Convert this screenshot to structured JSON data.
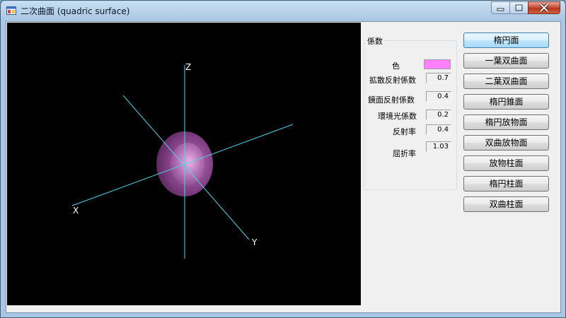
{
  "window": {
    "title": "二次曲面 (quadric surface)",
    "icon": "app-window-icon",
    "controls": [
      "minimize-icon",
      "maximize-icon",
      "close-icon"
    ]
  },
  "viewport": {
    "axes": {
      "x": "X",
      "y": "Y",
      "z": "Z"
    },
    "axis_color": "#4fd2e6",
    "surface_color": "#ff80ff",
    "background": "#000000"
  },
  "coefficients": {
    "group_title": "係数",
    "color_label": "色",
    "color_value": "#ff80ff",
    "diffuse_label": "拡散反射係数",
    "diffuse_value": "0.7",
    "specular_label": "鏡面反射係数",
    "specular_value": "0.4",
    "ambient_label": "環境光係数",
    "ambient_value": "0.2",
    "reflectance_label": "反射率",
    "reflectance_value": "0.4",
    "refractive_label": "屈折率",
    "refractive_value": "1.03"
  },
  "surfaces": [
    {
      "label": "楕円面",
      "selected": true
    },
    {
      "label": "一葉双曲面"
    },
    {
      "label": "二葉双曲面"
    },
    {
      "label": "楕円錐面"
    },
    {
      "label": "楕円放物面"
    },
    {
      "label": "双曲放物面"
    },
    {
      "label": "放物柱面"
    },
    {
      "label": "楕円柱面"
    },
    {
      "label": "双曲柱面"
    }
  ]
}
